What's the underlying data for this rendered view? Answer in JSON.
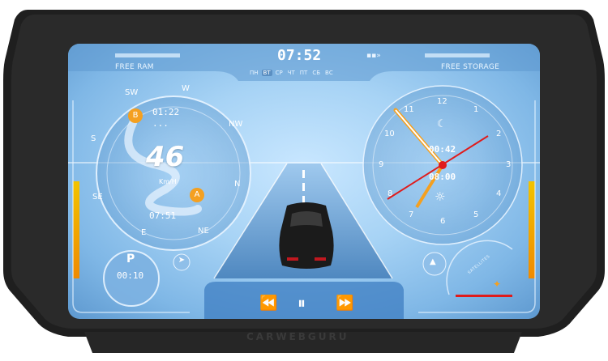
{
  "status": {
    "left_label": "FREE RAM",
    "right_label": "FREE STORAGE",
    "time": "07:52",
    "days": [
      "ПН",
      "ВТ",
      "СР",
      "ЧТ",
      "ПТ",
      "СБ",
      "ВС"
    ],
    "active_day": "ВТ"
  },
  "compass": {
    "speed": "46",
    "unit": "Km/H",
    "waypoint_b_letter": "B",
    "waypoint_a_letter": "A",
    "time_b": "01:22",
    "time_b_sub": "...",
    "time_a": "07:51",
    "directions": {
      "sw": "SW",
      "w": "W",
      "nw": "NW",
      "s": "S",
      "n": "N",
      "se": "SE",
      "e": "E",
      "ne": "NE"
    }
  },
  "parking": {
    "letter": "P",
    "time": "00:10"
  },
  "clock": {
    "numbers": {
      "twelve": "12",
      "three": "3",
      "six": "6",
      "nine": "9",
      "one": "1",
      "two": "2",
      "four": "4",
      "five": "5",
      "seven": "7",
      "eight": "8",
      "ten": "10",
      "eleven": "11"
    },
    "top_readout": "00:42",
    "bottom_readout": "08:00"
  },
  "satellites": {
    "label": "SATELLITES"
  },
  "media": {
    "prev_icon": "rewind-icon",
    "pause_icon": "pause-icon",
    "next_icon": "fast-forward-icon"
  },
  "brand": "CARWEBGURU",
  "colors": {
    "accent_orange": "#f4a020",
    "accent_red": "#e01b1b",
    "bezel": "#1c1c1c",
    "screen_blue": "#a7d3f5"
  }
}
